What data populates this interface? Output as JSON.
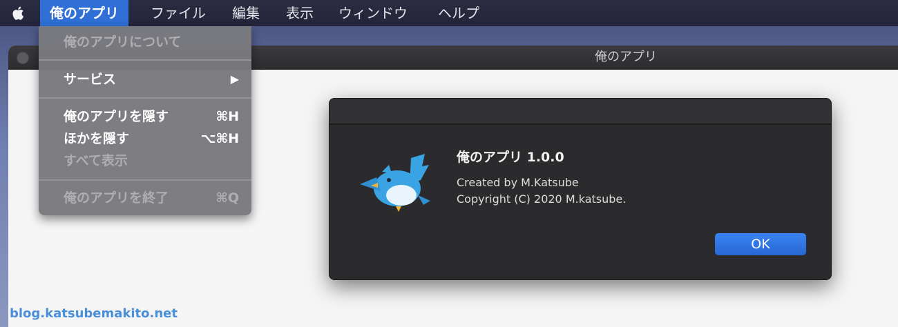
{
  "menubar": {
    "app_menu": "俺のアプリ",
    "items": [
      "ファイル",
      "編集",
      "表示",
      "ウィンドウ",
      "ヘルプ"
    ]
  },
  "app_menu_dropdown": {
    "about": "俺のアプリについて",
    "services": "サービス",
    "services_arrow": "▶",
    "hide_app": "俺のアプリを隠す",
    "hide_app_shortcut": "⌘H",
    "hide_others": "ほかを隠す",
    "hide_others_shortcut": "⌥⌘H",
    "show_all": "すべて表示",
    "quit": "俺のアプリを終了",
    "quit_shortcut": "⌘Q"
  },
  "window": {
    "title": "俺のアプリ"
  },
  "about_dialog": {
    "title": "俺のアプリ 1.0.0",
    "created_by": "Created by M.Katsube",
    "copyright": "Copyright (C) 2020 M.katsube.",
    "ok_label": "OK",
    "icon": "bird-icon"
  },
  "watermark": "blog.katsubemakito.net",
  "colors": {
    "menu_highlight": "#2f6fd6",
    "ok_button": "#2f75e6",
    "dialog_bg": "#2b2b2d",
    "bird_blue": "#3aa3e3"
  }
}
